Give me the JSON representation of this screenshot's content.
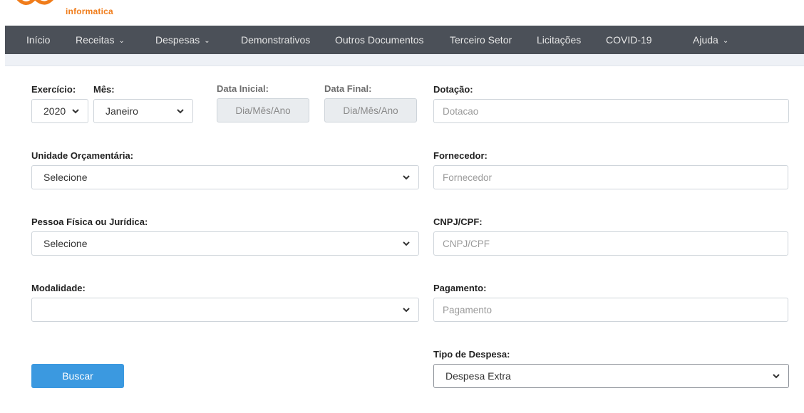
{
  "brand": {
    "name": "informatica",
    "accent": "#f07c1a"
  },
  "nav": {
    "items": [
      {
        "label": "Início"
      },
      {
        "label": "Receitas"
      },
      {
        "label": "Despesas"
      },
      {
        "label": "Demonstrativos"
      },
      {
        "label": "Outros Documentos"
      },
      {
        "label": "Terceiro Setor"
      },
      {
        "label": "Licitações"
      },
      {
        "label": "COVID-19"
      },
      {
        "label": "Ajuda"
      }
    ]
  },
  "form": {
    "exercicio": {
      "label": "Exercício:",
      "value": "2020"
    },
    "mes": {
      "label": "Mês:",
      "value": "Janeiro"
    },
    "data_inicial": {
      "label": "Data Inicial:",
      "placeholder": "Dia/Mês/Ano"
    },
    "data_final": {
      "label": "Data Final:",
      "placeholder": "Dia/Mês/Ano"
    },
    "dotacao": {
      "label": "Dotação:",
      "placeholder": "Dotacao"
    },
    "unidade": {
      "label": "Unidade Orçamentária:",
      "value": "Selecione"
    },
    "fornecedor": {
      "label": "Fornecedor:",
      "placeholder": "Fornecedor"
    },
    "pessoa": {
      "label": "Pessoa Física ou Jurídica:",
      "value": "Selecione"
    },
    "cnpj": {
      "label": "CNPJ/CPF:",
      "placeholder": "CNPJ/CPF"
    },
    "modalidade": {
      "label": "Modalidade:",
      "value": ""
    },
    "pagamento": {
      "label": "Pagamento:",
      "placeholder": "Pagamento"
    },
    "tipo_despesa": {
      "label": "Tipo de Despesa:",
      "value": "Despesa Extra"
    },
    "buscar": {
      "label": "Buscar"
    }
  },
  "colors": {
    "navbar": "#4b5058",
    "button": "#3b99e0"
  }
}
